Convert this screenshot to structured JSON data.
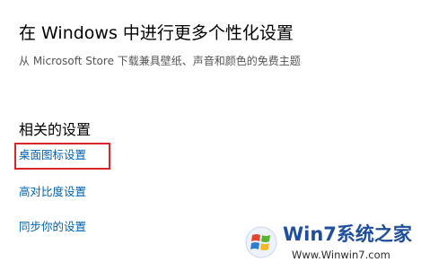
{
  "personalize": {
    "title": "在 Windows 中进行更多个性化设置",
    "subtitle": "从 Microsoft Store 下载兼具壁纸、声音和颜色的免费主题"
  },
  "related": {
    "title": "相关的设置",
    "links": [
      {
        "label": "桌面图标设置",
        "highlighted": true
      },
      {
        "label": "高对比度设置",
        "highlighted": false
      },
      {
        "label": "同步你的设置",
        "highlighted": false
      }
    ],
    "link_color": "#0063b1",
    "highlight_color": "#d9262a"
  },
  "watermark": {
    "brand": "Win7系统之家",
    "url": "Www.Winwin7.com",
    "logo_icon": "windows-flag-logo"
  }
}
